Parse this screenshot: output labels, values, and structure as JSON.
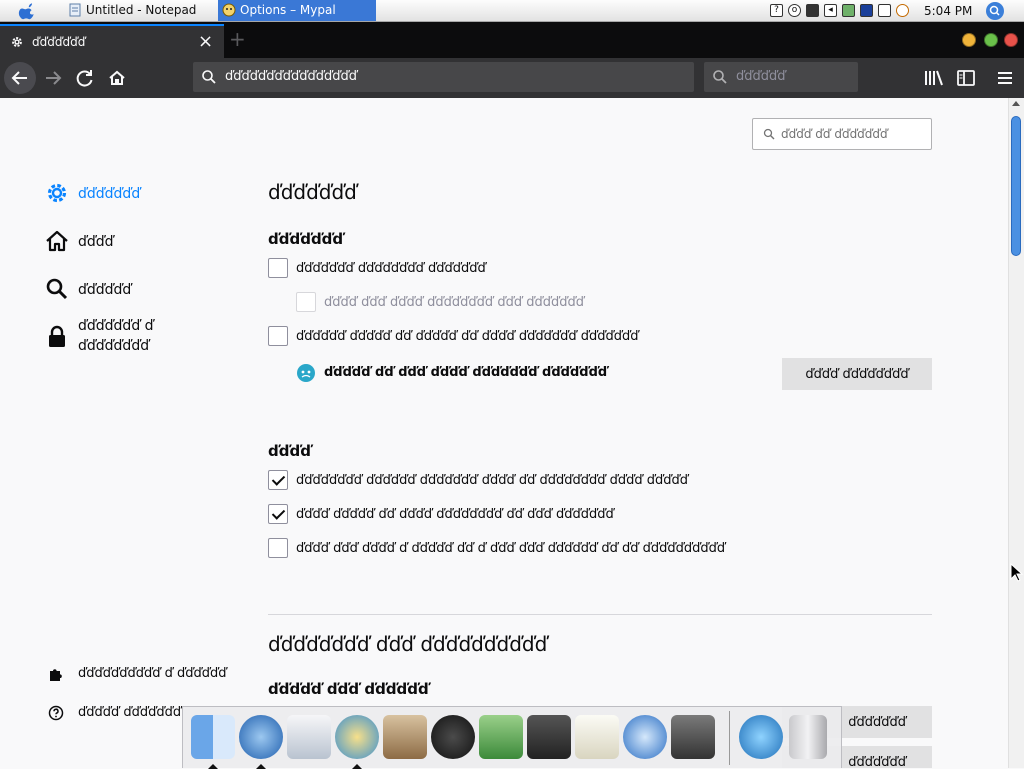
{
  "system_bar": {
    "tasks": [
      {
        "label": "Untitled - Notepad",
        "active": false
      },
      {
        "label": "Options – Mypal",
        "active": true
      }
    ],
    "clock": "5:04 PM",
    "accent": "#3a78d6"
  },
  "browser": {
    "tab": {
      "title": "ďďďďďďď"
    },
    "url": "ďďďďďďďďďďďďďďďď",
    "search_placeholder": "ďďďďďď",
    "accent": "#0a84ff"
  },
  "sidebar": {
    "items": [
      {
        "label": "ďďďďďďď",
        "icon": "gear-icon",
        "selected": true
      },
      {
        "label": "ďďďď",
        "icon": "home-icon",
        "selected": false
      },
      {
        "label": "ďďďďďď",
        "icon": "search-icon",
        "selected": false
      },
      {
        "label": "ďďďďďďď ď ďďďďďďďď",
        "icon": "lock-icon",
        "selected": false
      }
    ],
    "footer": [
      {
        "label": "ďďďďďďďďďď ď ďďďďďď",
        "icon": "puzzle-icon"
      },
      {
        "label": "ďďďďď ďďďďďďď",
        "icon": "help-icon"
      }
    ]
  },
  "main": {
    "find_placeholder": "ďďďď ďď ďďďďďďď",
    "heading": "ďďďďďďď",
    "startup": {
      "title": "ďďďďďďď",
      "options": [
        {
          "label": "ďďďďďďď ďďďďďďďď ďďďďďďď",
          "checked": false,
          "disabled": false
        },
        {
          "label": "ďďďď ďďď ďďďď ďďďďďďďď ďďď ďďďďďďď",
          "checked": false,
          "disabled": true
        },
        {
          "label": "ďďďďďď ďďďďď ďď ďďďďď ďď ďďďď ďďďďďďď ďďďďďďď",
          "checked": false,
          "disabled": false
        }
      ],
      "default_notice": "ďďďďď ďď ďďď ďďďď ďďďďďďď ďďďďďďď",
      "default_button": "ďďďď ďďďďďďďď"
    },
    "tabs": {
      "title": "ďďďď",
      "options": [
        {
          "label": "ďďďďďďďď ďďďďďď ďďďďďďď ďďďď ďď ďďďďďďďď ďďďď ďďďďď",
          "checked": true
        },
        {
          "label": "ďďďď ďďďďď ďď ďďďď ďďďďďďďď ďď ďďď ďďďďďďď",
          "checked": true
        },
        {
          "label": "ďďďď ďďď ďďďď ď ďďďďď ďď ď ďďď ďďď ďďďďďď ďď ďď ďďďďďďďďďď",
          "checked": false
        }
      ]
    },
    "language_section": {
      "title": "ďďďďďďďď ďďď ďďďďďďďďďď",
      "subtitle": "ďďďďď ďďď ďďďďďď",
      "button1": "ďďďďďďď",
      "button2": "ďďďďďďď"
    }
  }
}
